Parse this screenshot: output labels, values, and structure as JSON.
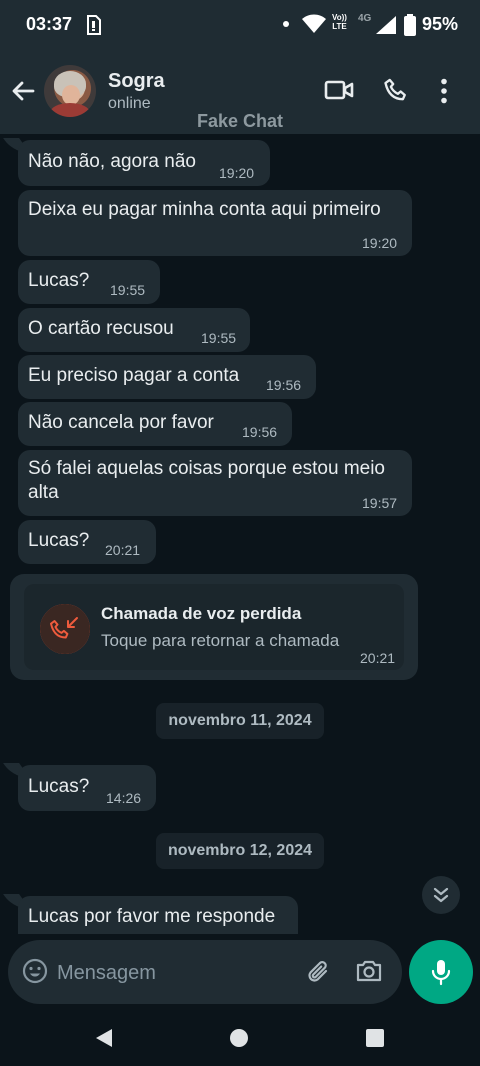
{
  "status": {
    "time": "03:37",
    "volte_top": "Vo))",
    "volte_bottom": "LTE",
    "network": "4G",
    "battery": "95%"
  },
  "header": {
    "name": "Sogra",
    "status": "online",
    "title": "Fake Chat"
  },
  "messages": [
    {
      "text": "Não não, agora não",
      "time": "19:20"
    },
    {
      "text": "Deixa eu pagar minha conta aqui primeiro",
      "time": "19:20"
    },
    {
      "text": "Lucas?",
      "time": "19:55"
    },
    {
      "text": "O cartão recusou",
      "time": "19:55"
    },
    {
      "text": "Eu preciso pagar a conta",
      "time": "19:56"
    },
    {
      "text": "Não cancela por favor",
      "time": "19:56"
    },
    {
      "text_line1": "Só falei aquelas coisas porque estou meio",
      "text_line2": "alta",
      "time": "19:57"
    },
    {
      "text": "Lucas?",
      "time": "20:21"
    }
  ],
  "missed_call": {
    "title": "Chamada de voz perdida",
    "subtitle": "Toque para retornar a chamada",
    "time": "20:21"
  },
  "date1": "novembro 11, 2024",
  "msg_after_date1": {
    "text": "Lucas?",
    "time": "14:26"
  },
  "date2": "novembro 12, 2024",
  "msg_after_date2": {
    "text": "Lucas por favor me responde"
  },
  "composer": {
    "placeholder": "Mensagem"
  },
  "colors": {
    "background": "#0b141a",
    "bubble": "#202c33",
    "accent": "#00a884",
    "missed": "#ef5b3d"
  }
}
